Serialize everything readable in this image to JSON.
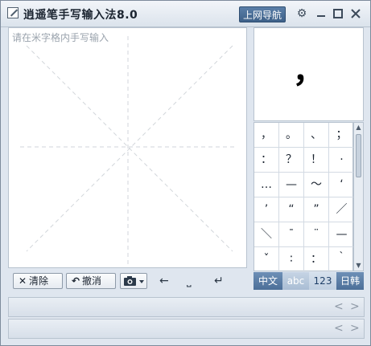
{
  "title": "逍遥笔手写输入法8.0",
  "nav_button": "上网导航",
  "title_icons": {
    "settings": "gear-icon",
    "minimize": "minimize-icon",
    "maximize": "maximize-icon",
    "close": "close-icon"
  },
  "pad": {
    "hint": "请在米字格内手写输入"
  },
  "toolbar": {
    "clear_label": "清除",
    "undo_label": "撤消",
    "camera": "camera-icon",
    "backspace": "←",
    "space": "⎵",
    "enter": "↵"
  },
  "preview_char": "，",
  "symbols": [
    [
      "，",
      "。",
      "、",
      "；"
    ],
    [
      "：",
      "？",
      "！",
      "·"
    ],
    [
      "…",
      "—",
      "～",
      "‘"
    ],
    [
      "’",
      "“",
      "”",
      "／"
    ],
    [
      "＼",
      "¯",
      "¨",
      "—"
    ],
    [
      "ˇ",
      "∶",
      "：",
      "｀"
    ]
  ],
  "modes": [
    "中文",
    "abc",
    "123",
    "日韩"
  ],
  "candidate_nav": {
    "prev": "<",
    "next": ">"
  }
}
